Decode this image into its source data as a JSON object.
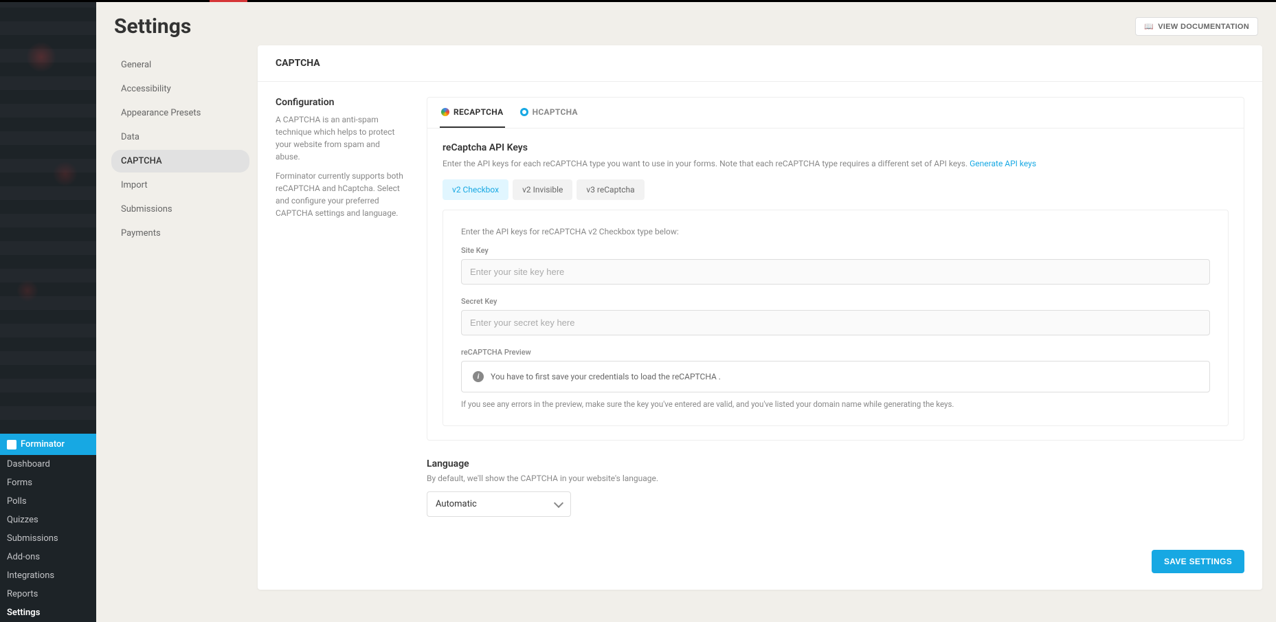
{
  "page": {
    "title": "Settings",
    "docBtn": "VIEW DOCUMENTATION"
  },
  "wpMenu": {
    "head": "Forminator",
    "items": [
      "Dashboard",
      "Forms",
      "Polls",
      "Quizzes",
      "Submissions",
      "Add-ons",
      "Integrations",
      "Reports",
      "Settings"
    ],
    "activeIndex": 8
  },
  "settingsNav": {
    "items": [
      "General",
      "Accessibility",
      "Appearance Presets",
      "Data",
      "CAPTCHA",
      "Import",
      "Submissions",
      "Payments"
    ],
    "activeIndex": 4
  },
  "panel": {
    "title": "CAPTCHA",
    "conf": {
      "title": "Configuration",
      "p1": "A CAPTCHA is an anti-spam technique which helps to protect your website from spam and abuse.",
      "p2": "Forminator currently supports both reCAPTCHA and hCaptcha. Select and configure your preferred CAPTCHA settings and language."
    },
    "captabs": {
      "recaptcha": "RECAPTCHA",
      "hcaptcha": "HCAPTCHA"
    },
    "api": {
      "title": "reCaptcha API Keys",
      "desc": "Enter the API keys for each reCAPTCHA type you want to use in your forms. Note that each reCAPTCHA type requires a different set of API keys. ",
      "link": "Generate API keys",
      "vtabs": {
        "v2c": "v2 Checkbox",
        "v2i": "v2 Invisible",
        "v3": "v3 reCaptcha"
      },
      "boxHint": "Enter the API keys for reCAPTCHA v2 Checkbox type below:",
      "siteLbl": "Site Key",
      "sitePh": "Enter your site key here",
      "secLbl": "Secret Key",
      "secPh": "Enter your secret key here",
      "prevLbl": "reCAPTCHA Preview",
      "prevMsg": "You have to first save your credentials to load the reCAPTCHA .",
      "note": "If you see any errors in the preview, make sure the key you've entered are valid, and you've listed your domain name while generating the keys."
    },
    "lang": {
      "title": "Language",
      "desc": "By default, we'll show the CAPTCHA in your website's language.",
      "value": "Automatic"
    },
    "save": "SAVE SETTINGS"
  }
}
